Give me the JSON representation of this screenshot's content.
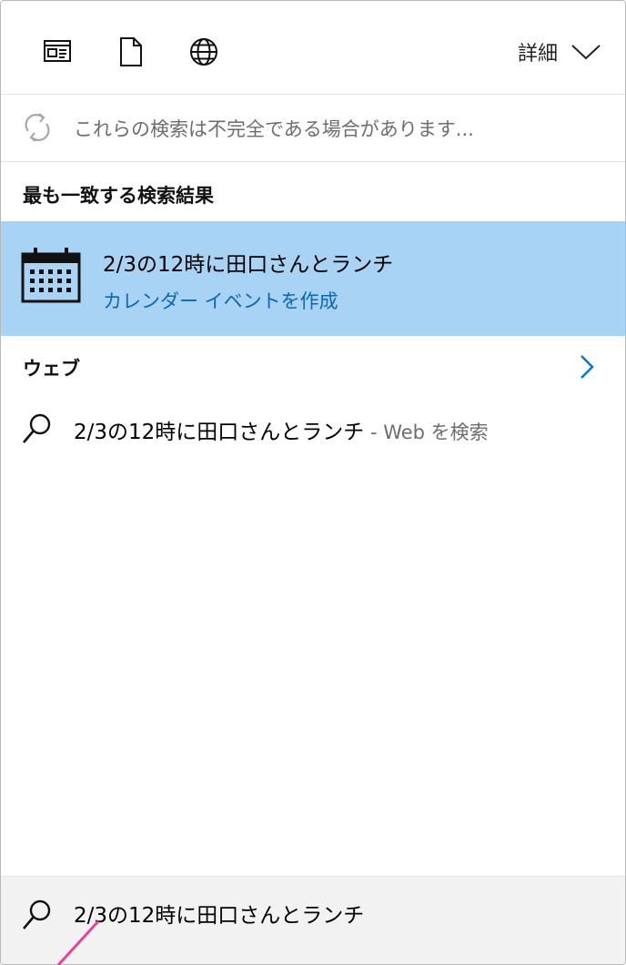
{
  "toolbar": {
    "icons": [
      "news-icon",
      "document-icon",
      "globe-icon"
    ],
    "details_label": "詳細"
  },
  "warning": {
    "text": "これらの検索は不完全である場合があります..."
  },
  "best_match": {
    "heading": "最も一致する検索結果",
    "title": "2/3の12時に田口さんとランチ",
    "subtitle": "カレンダー イベントを作成",
    "icon": "calendar-icon"
  },
  "web": {
    "heading": "ウェブ",
    "query": "2/3の12時に田口さんとランチ",
    "suffix": " - Web を検索"
  },
  "search": {
    "value": "2/3の12時に田口さんとランチ"
  },
  "colors": {
    "highlight": "#a9d3f5",
    "link": "#0a67b8",
    "accent": "#0078d7",
    "pointer": "#e6449a"
  }
}
